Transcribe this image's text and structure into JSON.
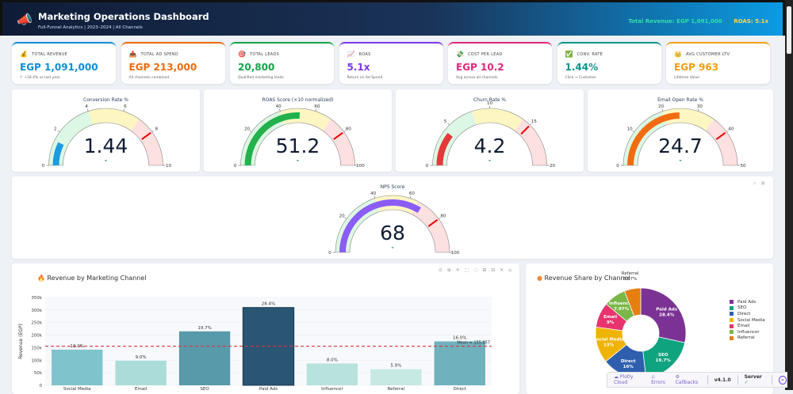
{
  "header": {
    "title": "Marketing Operations Dashboard",
    "subtitle": "Full-Funnel Analytics | 2023–2024 | All Channels",
    "total_revenue": "Total Revenue: EGP 1,091,000",
    "separator": "|",
    "roas": "ROAS: 5.1x",
    "icon": "megaphone-icon"
  },
  "kpis": [
    {
      "label": "TOTAL REVENUE",
      "value": "EGP 1,091,000",
      "sub": "↑ +18.4% vs last year",
      "color": "#0b8fd6",
      "icon": "money-bag-icon",
      "glyph": "💰"
    },
    {
      "label": "TOTAL AD SPEND",
      "value": "EGP 213,000",
      "sub": "All channels combined",
      "color": "#f06a0f",
      "icon": "outbox-icon",
      "glyph": "📤"
    },
    {
      "label": "TOTAL LEADS",
      "value": "20,800",
      "sub": "Qualified marketing leads",
      "color": "#16a34a",
      "icon": "target-icon",
      "glyph": "🎯"
    },
    {
      "label": "ROAS",
      "value": "5.1x",
      "sub": "Return on Ad Spend",
      "color": "#7c3aed",
      "icon": "chart-up-icon",
      "glyph": "📈"
    },
    {
      "label": "COST PER LEAD",
      "value": "EGP 10.2",
      "sub": "Avg across all channels",
      "color": "#e0287a",
      "icon": "money-wings-icon",
      "glyph": "💸"
    },
    {
      "label": "CONV. RATE",
      "value": "1.44%",
      "sub": "Click → Customer",
      "color": "#0d9488",
      "icon": "check-icon",
      "glyph": "✅"
    },
    {
      "label": "AVG CUSTOMER LTV",
      "value": "EGP 963",
      "sub": "Lifetime Value",
      "color": "#f59e0b",
      "icon": "crown-icon",
      "glyph": "👑"
    }
  ],
  "gauges": [
    {
      "title": "Conversion Rate %",
      "value": 1.44,
      "display": "1.44",
      "delta": "-",
      "min": 0,
      "max": 10,
      "ticks": [
        0,
        2,
        4,
        6,
        8,
        10
      ],
      "steps": [
        [
          0,
          4,
          "#dcf7e3"
        ],
        [
          4,
          7,
          "#fdf6c3"
        ],
        [
          7,
          10,
          "#fde0e0"
        ]
      ],
      "threshold": 8,
      "bar_color": "#1e9be0"
    },
    {
      "title": "ROAS Score (×10 normalized)",
      "value": 51.2,
      "display": "51.2",
      "delta": "-",
      "min": 0,
      "max": 100,
      "ticks": [
        0,
        20,
        40,
        60,
        80,
        100
      ],
      "steps": [
        [
          0,
          40,
          "#dcf7e3"
        ],
        [
          40,
          70,
          "#fdf6c3"
        ],
        [
          70,
          100,
          "#fde0e0"
        ]
      ],
      "threshold": 80,
      "bar_color": "#22b14c"
    },
    {
      "title": "Churn Rate %",
      "value": 4.2,
      "display": "4.2",
      "delta": "-",
      "min": 0,
      "max": 20,
      "ticks": [
        0,
        5,
        10,
        15,
        20
      ],
      "steps": [
        [
          0,
          8,
          "#dcf7e3"
        ],
        [
          8,
          14,
          "#fdf6c3"
        ],
        [
          14,
          20,
          "#fde0e0"
        ]
      ],
      "threshold": 15,
      "bar_color": "#e53939"
    },
    {
      "title": "Email Open Rate %",
      "value": 24.7,
      "display": "24.7",
      "delta": "-",
      "min": 0,
      "max": 50,
      "ticks": [
        0,
        10,
        20,
        30,
        40,
        50
      ],
      "steps": [
        [
          0,
          20,
          "#dcf7e3"
        ],
        [
          20,
          35,
          "#fdf6c3"
        ],
        [
          35,
          50,
          "#fde0e0"
        ]
      ],
      "threshold": 40,
      "bar_color": "#f26b0f"
    },
    {
      "title": "NPS Score",
      "value": 68,
      "display": "68",
      "delta": "-",
      "min": 0,
      "max": 100,
      "ticks": [
        0,
        20,
        40,
        60,
        80,
        100
      ],
      "steps": [
        [
          0,
          40,
          "#dcf7e3"
        ],
        [
          40,
          65,
          "#fdf6c3"
        ],
        [
          65,
          100,
          "#fde0e0"
        ]
      ],
      "threshold": 80,
      "bar_color": "#8b5cf6"
    }
  ],
  "chart_data": [
    {
      "type": "bar",
      "title": "Revenue by Marketing Channel",
      "title_icon": "fire-icon",
      "ylabel": "Revenue (EGP)",
      "ylim": [
        0,
        350000
      ],
      "yticks": [
        "0",
        "50k",
        "100k",
        "150k",
        "200k",
        "250k",
        "300k",
        "350k"
      ],
      "categories": [
        "Social Media",
        "Email",
        "SEO",
        "Paid Ads",
        "Influencer",
        "Referral",
        "Direct"
      ],
      "values": [
        142000,
        98000,
        215000,
        310000,
        87000,
        64000,
        175000
      ],
      "labels": [
        "13.0%",
        "9.0%",
        "19.7%",
        "28.4%",
        "8.0%",
        "5.9%",
        "16.0%"
      ],
      "colors": [
        "#7fc4cc",
        "#abdcd9",
        "#5899aa",
        "#2a5573",
        "#b8e2dc",
        "#c6e9e3",
        "#6fb1bd"
      ],
      "mean": 155857,
      "mean_label": "Mean = 155,857",
      "grid": true
    },
    {
      "type": "pie",
      "title": "Revenue Share by Channel",
      "title_icon": "globe-icon",
      "hole": 0.4,
      "categories": [
        "Paid Ads",
        "SEO",
        "Direct",
        "Social Media",
        "Email",
        "Influencer",
        "Referral"
      ],
      "values": [
        28.4,
        19.7,
        16,
        13,
        9,
        7.97,
        5.87
      ],
      "labels": [
        "28.4%",
        "19.7%",
        "16%",
        "13%",
        "9%",
        "7.97%",
        "5.87%"
      ],
      "colors": [
        "#7b3294",
        "#10a37f",
        "#2e5fae",
        "#f0b400",
        "#e8336e",
        "#7ab648",
        "#e67e10"
      ],
      "legend": "right"
    }
  ],
  "modebar": "⊙ ⊕ ✛ ⬚ ◌ ⊞ ⊟ ✕ ⌂",
  "devtools": {
    "cloud": "Plotly Cloud",
    "errors": "Errors",
    "callbacks": "Callbacks",
    "version": "v4.1.0",
    "server": "Server"
  }
}
